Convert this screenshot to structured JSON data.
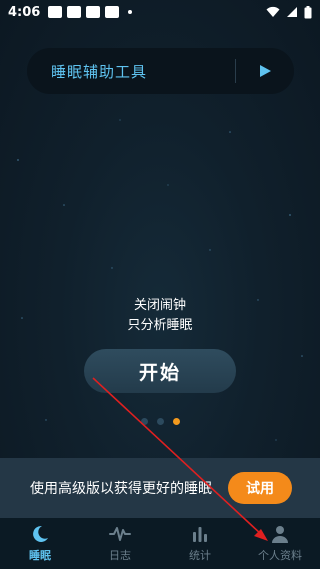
{
  "status_bar": {
    "time": "4:06"
  },
  "tool_bar": {
    "title": "睡眠辅助工具"
  },
  "mode": {
    "line1": "关闭闹钟",
    "line2": "只分析睡眠"
  },
  "start_label": "开始",
  "pager": {
    "count": 3,
    "active_index": 2
  },
  "promo": {
    "text": "使用高级版以获得更好的睡眠",
    "trial_label": "试用"
  },
  "tabs": [
    {
      "label": "睡眠",
      "icon": "moon-icon",
      "active": true
    },
    {
      "label": "日志",
      "icon": "wave-icon",
      "active": false
    },
    {
      "label": "统计",
      "icon": "bar-chart-icon",
      "active": false
    },
    {
      "label": "个人资料",
      "icon": "person-icon",
      "active": false
    }
  ],
  "colors": {
    "accent_blue": "#5fc3f0",
    "accent_orange": "#f48a1a",
    "arrow_red": "#e02020"
  }
}
